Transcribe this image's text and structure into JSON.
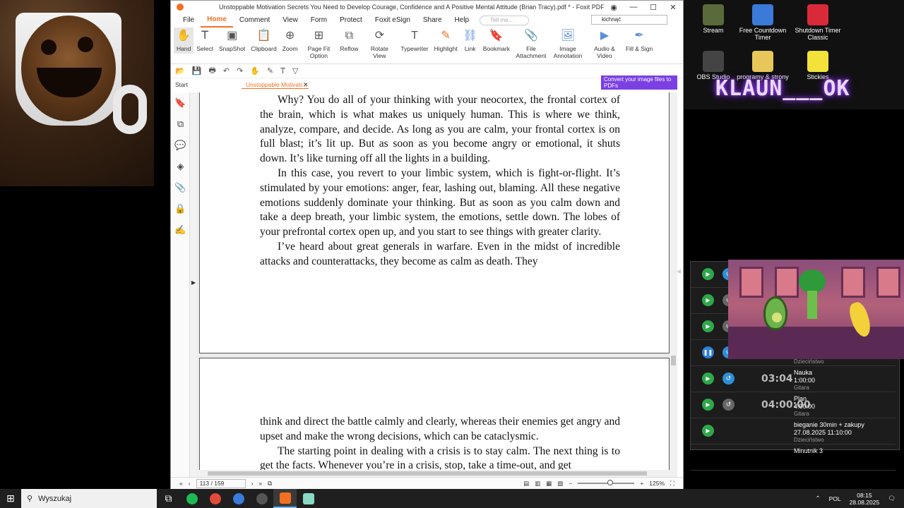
{
  "window": {
    "title": "Unstoppable Motivation Secrets You Need to Develop Courage, Confidence and A Positive Mental Attitude (Brian Tracy).pdf * - Foxit PDF Reader"
  },
  "menu": [
    "File",
    "Home",
    "Comment",
    "View",
    "Form",
    "Protect",
    "Foxit eSign",
    "Share",
    "Help"
  ],
  "tell_me": "Tell me...",
  "search_value": "kichnąć",
  "ribbon": [
    {
      "label": "Hand",
      "icon": "hand-icon",
      "glyph": "✋"
    },
    {
      "label": "Select",
      "icon": "select-icon",
      "glyph": "𝖳"
    },
    {
      "label": "SnapShot",
      "icon": "snapshot-icon",
      "glyph": "▣"
    },
    {
      "label": "Clipboard",
      "icon": "clipboard-icon",
      "glyph": "📋"
    },
    {
      "label": "Zoom",
      "icon": "zoom-icon",
      "glyph": "⊕"
    },
    {
      "label": "Page Fit Option",
      "icon": "page-fit-icon",
      "glyph": "⊞"
    },
    {
      "label": "Reflow",
      "icon": "reflow-icon",
      "glyph": "⧉"
    },
    {
      "label": "Rotate View",
      "icon": "rotate-icon",
      "glyph": "⟳"
    },
    {
      "label": "Typewriter",
      "icon": "typewriter-icon",
      "glyph": "T"
    },
    {
      "label": "Highlight",
      "icon": "highlight-icon",
      "glyph": "✎"
    },
    {
      "label": "Link",
      "icon": "link-icon",
      "glyph": "⛓"
    },
    {
      "label": "Bookmark",
      "icon": "bookmark-icon",
      "glyph": "🔖"
    },
    {
      "label": "File Attachment",
      "icon": "attachment-icon",
      "glyph": "📎"
    },
    {
      "label": "Image Annotation",
      "icon": "image-annotation-icon",
      "glyph": "🖼"
    },
    {
      "label": "Audio & Video",
      "icon": "audio-video-icon",
      "glyph": "▶"
    },
    {
      "label": "Fill & Sign",
      "icon": "fill-sign-icon",
      "glyph": "✒"
    }
  ],
  "tabs": {
    "start": "Start",
    "document": "Unstoppable Motivati..."
  },
  "convert_ad": "Convert your image files to PDFs",
  "page_top_paragraphs": [
    "Why? You do all of your thinking with your neocortex, the frontal cortex of the brain, which is what makes us uniquely human. This is where we think, analyze, compare, and decide. As long as you are calm, your frontal cortex is on full blast; it’s lit up. But as soon as you become angry or emotional, it shuts down. It’s like turning off all the lights in a building.",
    "In this case, you revert to your limbic system, which is fight-or-flight. It’s stimulated by your emotions: anger, fear, lashing out, blaming. All these negative emotions suddenly dominate your thinking. But as soon as you calm down and take a deep breath, your limbic system, the emotions, settle down. The lobes of your prefrontal cortex open up, and you start to see things with greater clarity.",
    "I’ve heard about great generals in warfare. Even in the midst of incredible attacks and counterattacks, they become as calm as death. They"
  ],
  "page_bottom_paragraphs": [
    "think and direct the battle calmly and clearly, whereas their enemies get angry and upset and make the wrong decisions, which can be cataclysmic.",
    "The starting point in dealing with a crisis is to stay calm. The next thing is to get the facts. Whenever you’re in a crisis, stop, take a time-out, and get"
  ],
  "status": {
    "page_counter": "113 / 159",
    "zoom": "125%"
  },
  "desktop_icons": [
    {
      "label": "Stream",
      "color": "#5a6a3a"
    },
    {
      "label": "Free Countdown Timer",
      "color": "#3a7ad9"
    },
    {
      "label": "Shutdown Timer Classic",
      "color": "#d92a3a"
    },
    {
      "label": "OBS Studio",
      "color": "#444444"
    },
    {
      "label": "programy & strony",
      "color": "#e8c75a"
    },
    {
      "label": "Stickies",
      "color": "#f2e23a"
    }
  ],
  "banner_text": "KLAUN___OK",
  "timers": [
    {
      "time": "",
      "name": "",
      "duration": "",
      "category": "",
      "state": "play",
      "reset": "blue"
    },
    {
      "time": "",
      "name": "",
      "duration": "",
      "category": "",
      "state": "play",
      "reset": "gray"
    },
    {
      "time": "",
      "name": "",
      "duration": "",
      "category": "",
      "state": "play",
      "reset": "gray"
    },
    {
      "time": "",
      "name": "",
      "duration": "",
      "category": "Dzieciństwo",
      "state": "pause",
      "reset": "blue"
    },
    {
      "time": "03:04",
      "name": "Nauka",
      "duration": "1:00:00",
      "category": "Gitara",
      "state": "play",
      "reset": "blue"
    },
    {
      "time": "04:00:00",
      "name": "Plan",
      "duration": "4:00:00",
      "category": "Gitara",
      "state": "play",
      "reset": "gray"
    },
    {
      "time": "",
      "name": "bieganie 30min + zakupy",
      "duration": "27.08.2025 11:10:00",
      "category": "Dzieciństwo",
      "state": "play",
      "reset": "none"
    },
    {
      "time": "",
      "name": "Minutnik 3",
      "duration": "",
      "category": "",
      "state": "none",
      "reset": "none"
    }
  ],
  "taskbar": {
    "search_placeholder": "Wyszukaj",
    "language": "POL",
    "time": "08:15",
    "date": "28.08.2025"
  },
  "colors": {
    "accent": "#f36f21",
    "ad_purple": "#7b3fe4",
    "timer_play": "#2ea84a"
  }
}
